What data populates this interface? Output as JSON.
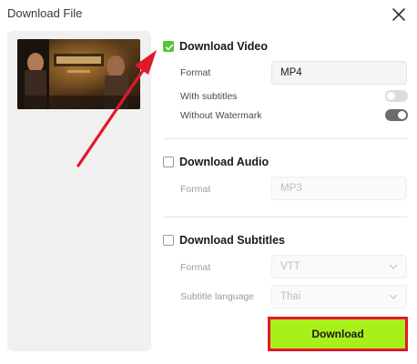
{
  "dialog": {
    "title": "Download File"
  },
  "video": {
    "heading": "Download Video",
    "checked": true,
    "format_label": "Format",
    "format_value": "MP4",
    "subtitles_label": "With subtitles",
    "subtitles_on": false,
    "watermark_label": "Without Watermark",
    "watermark_on": true
  },
  "audio": {
    "heading": "Download Audio",
    "checked": false,
    "format_label": "Format",
    "format_value": "MP3"
  },
  "subtitles": {
    "heading": "Download Subtitles",
    "checked": false,
    "format_label": "Format",
    "format_value": "VTT",
    "language_label": "Subtitle language",
    "language_value": "Thai"
  },
  "actions": {
    "download_label": "Download"
  },
  "icons": {
    "close": "close-icon",
    "check": "check-icon",
    "chevron": "chevron-down-icon"
  },
  "colors": {
    "accent_green": "#57c33a",
    "download_bg": "#a8f01a",
    "highlight_red": "#e0192b"
  }
}
